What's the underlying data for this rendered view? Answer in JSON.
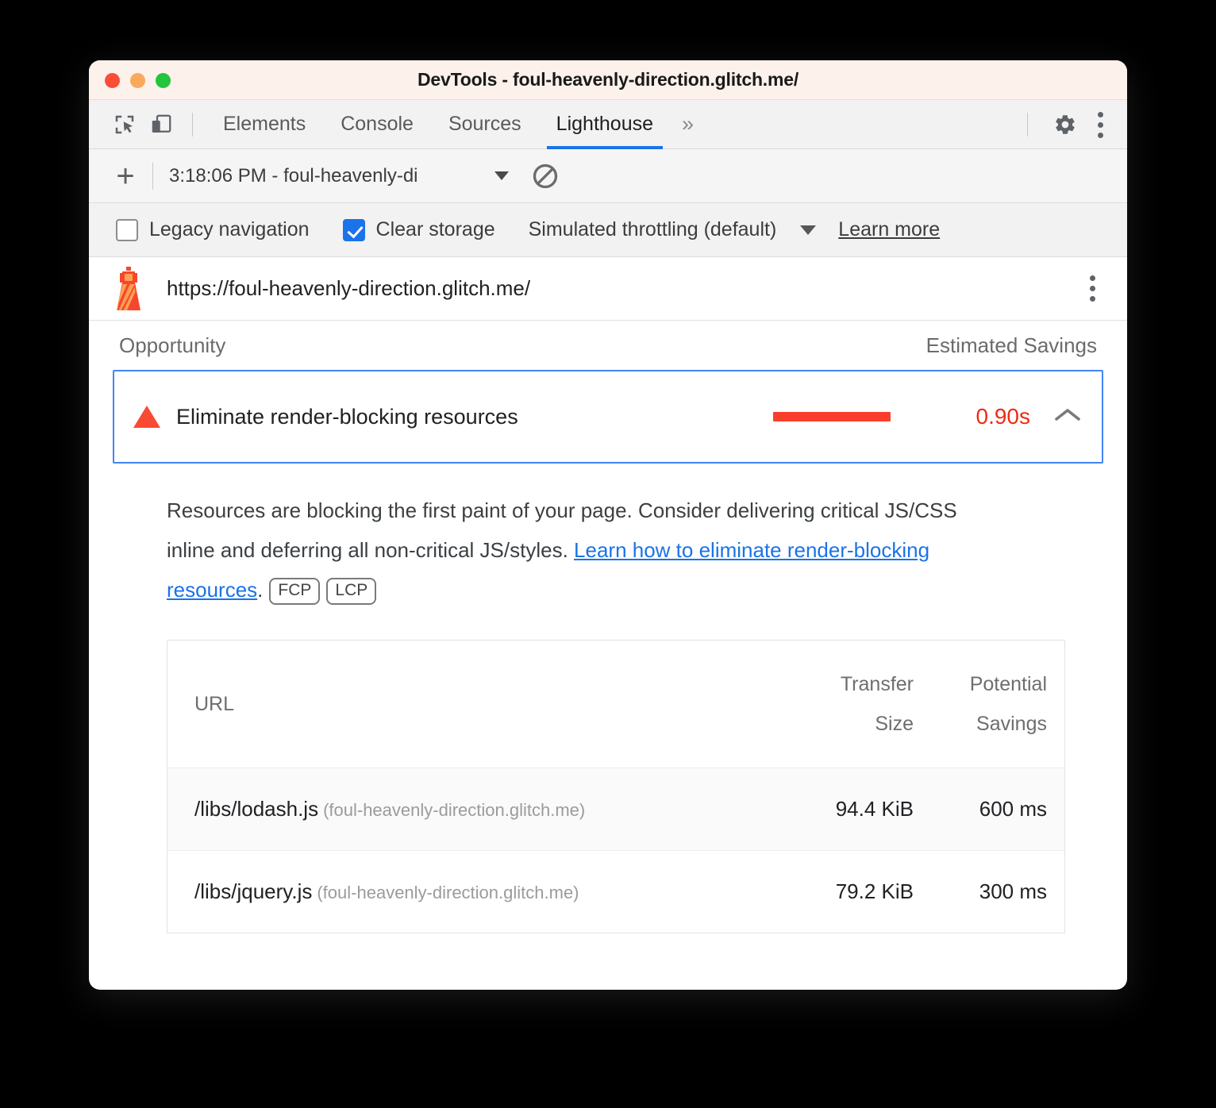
{
  "window": {
    "title": "DevTools - foul-heavenly-direction.glitch.me/"
  },
  "tabbar": {
    "icons": {
      "inspect": "inspect-element-icon",
      "device": "device-toolbar-icon",
      "settings": "gear-icon",
      "menu": "kebab-menu-icon",
      "more_tabs": "»"
    },
    "tabs": [
      {
        "label": "Elements",
        "active": false
      },
      {
        "label": "Console",
        "active": false
      },
      {
        "label": "Sources",
        "active": false
      },
      {
        "label": "Lighthouse",
        "active": true
      }
    ]
  },
  "runbar": {
    "add_label": "+",
    "report_select": "3:18:06 PM - foul-heavenly-di",
    "clear_icon": "no-entry-icon"
  },
  "settings": {
    "legacy_navigation": {
      "label": "Legacy navigation",
      "checked": false
    },
    "clear_storage": {
      "label": "Clear storage",
      "checked": true
    },
    "throttling": "Simulated throttling (default)",
    "learn_more": "Learn more"
  },
  "report": {
    "url": "https://foul-heavenly-direction.glitch.me/",
    "icon": "lighthouse-icon",
    "menu_icon": "kebab-menu-icon"
  },
  "opportunity_section": {
    "col_left": "Opportunity",
    "col_right": "Estimated Savings",
    "row": {
      "severity_icon": "warning-triangle-icon",
      "title": "Eliminate render-blocking resources",
      "savings": "0.90s",
      "expanded": true,
      "toggle_icon": "chevron-up-icon",
      "bar_color": "#f83f2c",
      "savings_color": "#ee2a15"
    },
    "description": {
      "part1": "Resources are blocking the first paint of your page. Consider delivering critical JS/CSS inline and deferring all non-critical JS/styles. ",
      "link": "Learn how to eliminate render-blocking resources",
      "part2": ".",
      "badges": [
        "FCP",
        "LCP"
      ]
    },
    "table": {
      "columns": [
        "URL",
        "Transfer Size",
        "Potential Savings"
      ],
      "column_labels": {
        "url": "URL",
        "transfer_size_line1": "Transfer",
        "transfer_size_line2": "Size",
        "potential_savings_line1": "Potential",
        "potential_savings_line2": "Savings"
      },
      "rows": [
        {
          "path": "/libs/lodash.js",
          "host": "(foul-heavenly-direction.glitch.me)",
          "transfer_size": "94.4 KiB",
          "potential_savings": "600 ms"
        },
        {
          "path": "/libs/jquery.js",
          "host": "(foul-heavenly-direction.glitch.me)",
          "transfer_size": "79.2 KiB",
          "potential_savings": "300 ms"
        }
      ]
    }
  },
  "colors": {
    "accent_blue": "#1a73e8",
    "selection_border": "#4285f4",
    "error_red": "#f83f2c",
    "titlebar_bg": "#fdf1ec"
  }
}
